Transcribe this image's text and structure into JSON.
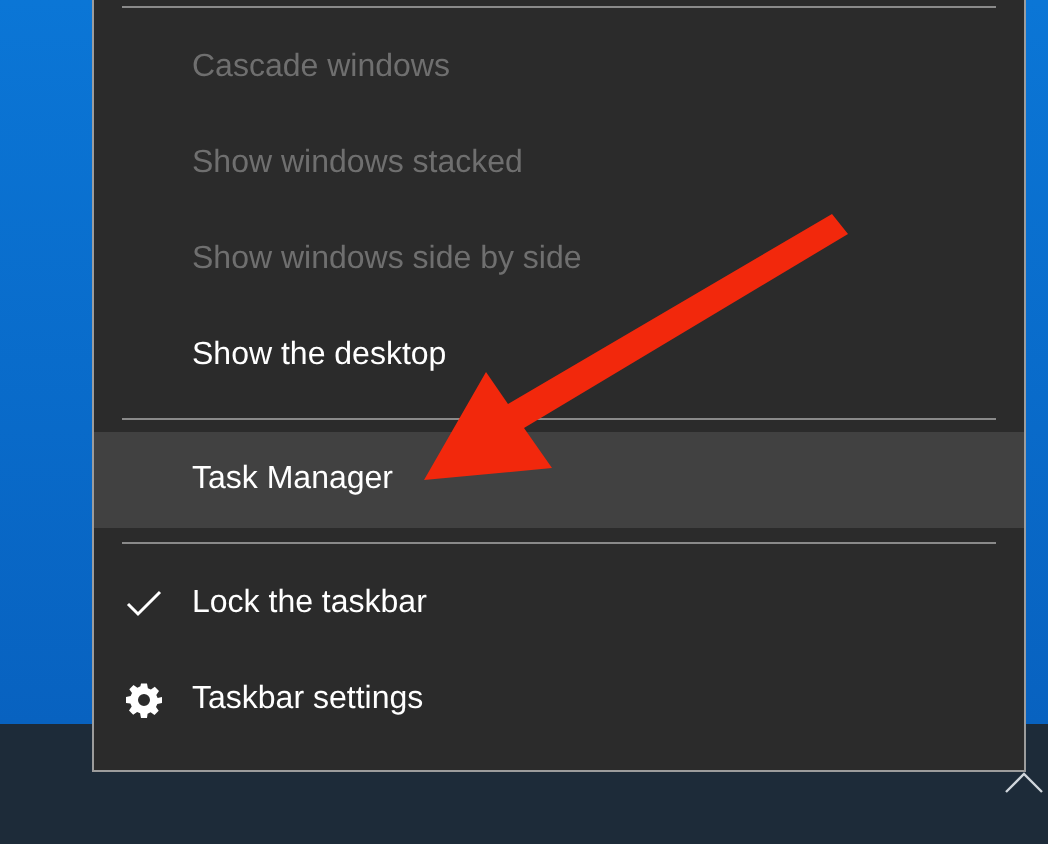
{
  "menu": {
    "items": [
      {
        "kind": "separator"
      },
      {
        "kind": "command",
        "label": "Cascade windows",
        "disabled": true,
        "selected": false
      },
      {
        "kind": "command",
        "label": "Show windows stacked",
        "disabled": true,
        "selected": false
      },
      {
        "kind": "command",
        "label": "Show windows side by side",
        "disabled": true,
        "selected": false
      },
      {
        "kind": "command",
        "label": "Show the desktop",
        "disabled": false,
        "selected": false
      },
      {
        "kind": "separator"
      },
      {
        "kind": "command",
        "label": "Task Manager",
        "disabled": false,
        "selected": true
      },
      {
        "kind": "separator"
      },
      {
        "kind": "toggle",
        "label": "Lock the taskbar",
        "disabled": false,
        "selected": false,
        "checked": true
      },
      {
        "kind": "settings",
        "label": "Taskbar settings",
        "disabled": false,
        "selected": false
      }
    ]
  }
}
